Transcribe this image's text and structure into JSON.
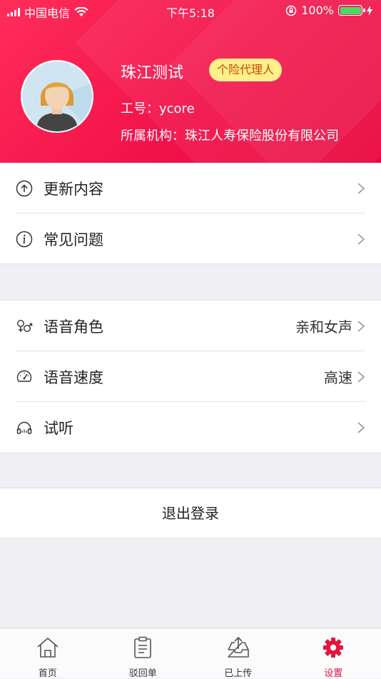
{
  "status_bar": {
    "carrier": "中国电信",
    "time": "下午5:18",
    "battery": "100%"
  },
  "profile": {
    "name": "珠江测试",
    "badge": "个险代理人",
    "employee_id_label": "工号：ycore",
    "organization_label": "所属机构：珠江人寿保险股份有限公司"
  },
  "menu_group1": [
    {
      "label": "更新内容",
      "icon": "upload-circle-icon"
    },
    {
      "label": "常见问题",
      "icon": "info-circle-icon"
    }
  ],
  "menu_group2": [
    {
      "label": "语音角色",
      "value": "亲和女声",
      "icon": "gender-icon"
    },
    {
      "label": "语音速度",
      "value": "高速",
      "icon": "speed-gauge-icon"
    },
    {
      "label": "试听",
      "value": "",
      "icon": "headphones-icon"
    }
  ],
  "logout_label": "退出登录",
  "tabs": [
    {
      "label": "首页",
      "icon": "home-icon",
      "active": false
    },
    {
      "label": "驳回单",
      "icon": "clipboard-icon",
      "active": false
    },
    {
      "label": "已上传",
      "icon": "inbox-upload-icon",
      "active": false
    },
    {
      "label": "设置",
      "icon": "gear-icon",
      "active": true
    }
  ],
  "colors": {
    "brand": "#f2124a",
    "badge_bg": "#fff08c",
    "active_tab": "#e0163f",
    "page_bg": "#efeff4"
  }
}
